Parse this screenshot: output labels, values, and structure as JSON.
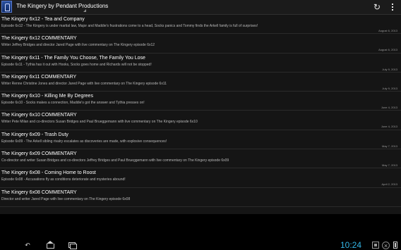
{
  "app": {
    "title": "The Kingery by Pendant Productions"
  },
  "toolbar": {
    "refresh_icon": "refresh-icon",
    "overflow_icon": "overflow-menu-icon"
  },
  "episodes": [
    {
      "title": "The Kingery 6x12 - Tea and Company",
      "description": "Episode 6x12 - The Kingery is under martial law, Major and Maddie's frustrations come to a head, Socks panics and Tommy finds the Arkell family is full of surprises!",
      "date": "August 6, 2013"
    },
    {
      "title": "The Kingery 6x12 COMMENTARY",
      "description": "Writer Jeffrey Bridges and director Jared Page with live commentary on The Kingery episode 6x12",
      "date": "August 6, 2013"
    },
    {
      "title": "The Kingery 6x11 - The Family You Choose, The Family You Lose",
      "description": "Episode 6x11 - Tythia has it out with Hooks, Socks goes home and Richards will not be stopped!",
      "date": "July 9, 2013"
    },
    {
      "title": "The Kingery 6x11 COMMENTARY",
      "description": "Writer Renne Christine Jones and director Jared Page with live commentary on The Kingery episode 6x11",
      "date": "July 9, 2013"
    },
    {
      "title": "The Kingery 6x10 - Killing Me By Degrees",
      "description": "Episode 6x10 - Socks makes a connection, Maddie's got the answer and Tythia presses on!",
      "date": "June 4, 2013"
    },
    {
      "title": "The Kingery 6x10 COMMENTARY",
      "description": "Writer Pete Milan and co-directors Susan Bridges and Paul Brueggemann with live commentary on The Kingery episode 6x10",
      "date": "June 4, 2013"
    },
    {
      "title": "The Kingery 6x09 - Trash Duty",
      "description": "Episode 6x09 - The Arkell sibling rivalry escalates as discoveries are made, with explosive consequences!",
      "date": "May 7, 2013"
    },
    {
      "title": "The Kingery 6x09 COMMENTARY",
      "description": "Co-director and writer Susan Bridges and co-directors Jeffrey Bridges and Paul Brueggemann with live commentary on The Kingery episode 6x09",
      "date": "May 7, 2013"
    },
    {
      "title": "The Kingery 6x08 - Coming Home to Roost",
      "description": "Episode 6x08 - Accusations fly as conditions deteriorate and mysteries abound!",
      "date": "April 2, 2013"
    },
    {
      "title": "The Kingery 6x08 COMMENTARY",
      "description": "Director and writer Jared Page with live commentary on The Kingery episode 6x08",
      "date": ""
    }
  ],
  "system": {
    "clock": "10:24",
    "accent_color": "#33b5e5"
  }
}
